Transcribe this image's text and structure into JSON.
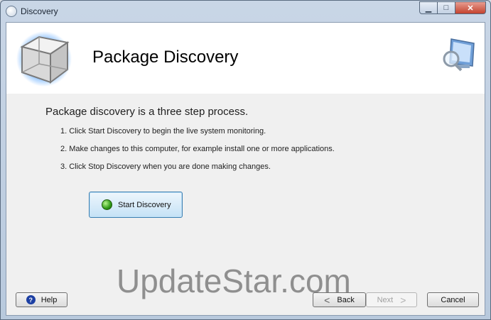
{
  "window": {
    "title": "Discovery",
    "controls": {
      "minimize": "▁",
      "maximize": "□",
      "close": "✕"
    }
  },
  "header": {
    "title": "Package Discovery"
  },
  "main": {
    "intro": "Package discovery is a three step process.",
    "steps": [
      "1.  Click Start Discovery to begin the live system monitoring.",
      "2.  Make changes to this computer, for example install one or more applications.",
      "3.  Click Stop Discovery when you are done making changes."
    ],
    "start_button": "Start Discovery"
  },
  "watermark": "UpdateStar.com",
  "footer": {
    "help_icon": "?",
    "help": "Help",
    "back_chevron": "<",
    "back": "Back",
    "next": "Next",
    "next_chevron": ">",
    "cancel": "Cancel"
  },
  "icons": [
    "cube-icon",
    "monitor-search-icon",
    "green-status-icon",
    "help-icon",
    "app-icon"
  ]
}
